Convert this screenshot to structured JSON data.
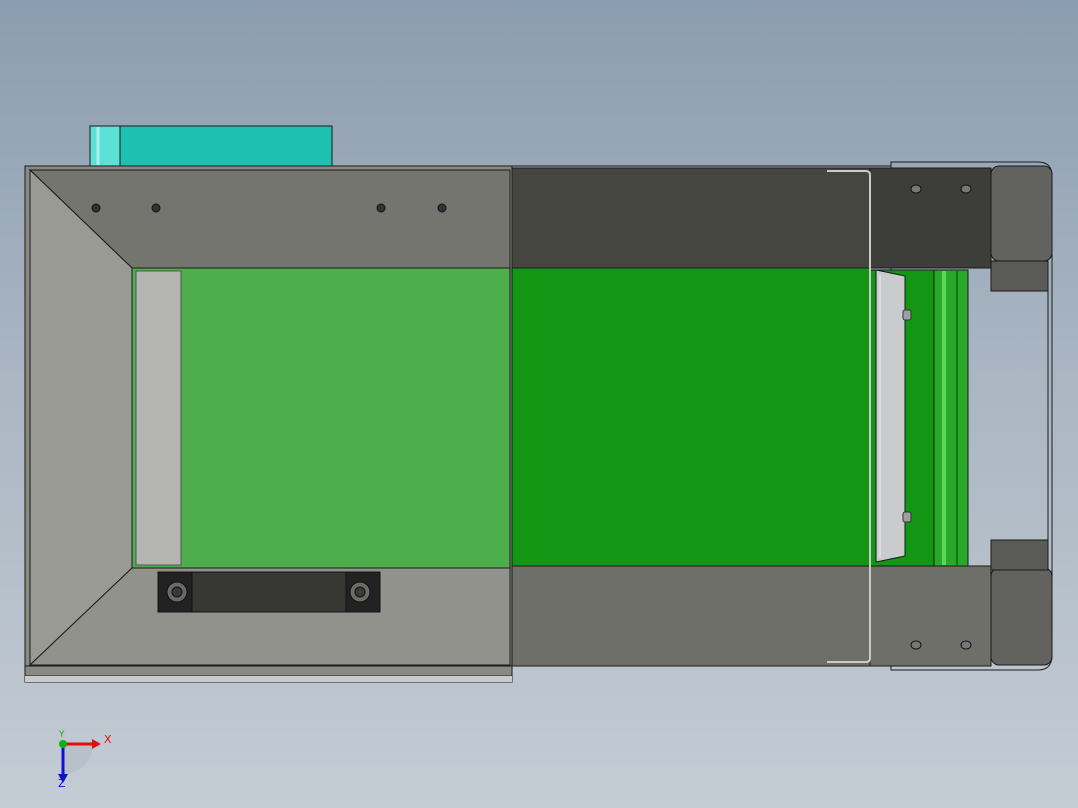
{
  "viewport": {
    "background_top": "#8b9db0",
    "background_bottom": "#c4ccd4"
  },
  "model": {
    "frame_color": "#8e8e88",
    "dark_cover_color": "#454640",
    "belt_color": "#129614",
    "belt_translucent_color": "#4fae4c",
    "motor_color": "#1ec0b0",
    "hopper_color": "#9a9a94"
  },
  "triad": {
    "x_label": "X",
    "y_label": "Y",
    "z_label": "Z",
    "x_color": "#e01010",
    "y_color": "#10b010",
    "z_color": "#1010d0"
  }
}
